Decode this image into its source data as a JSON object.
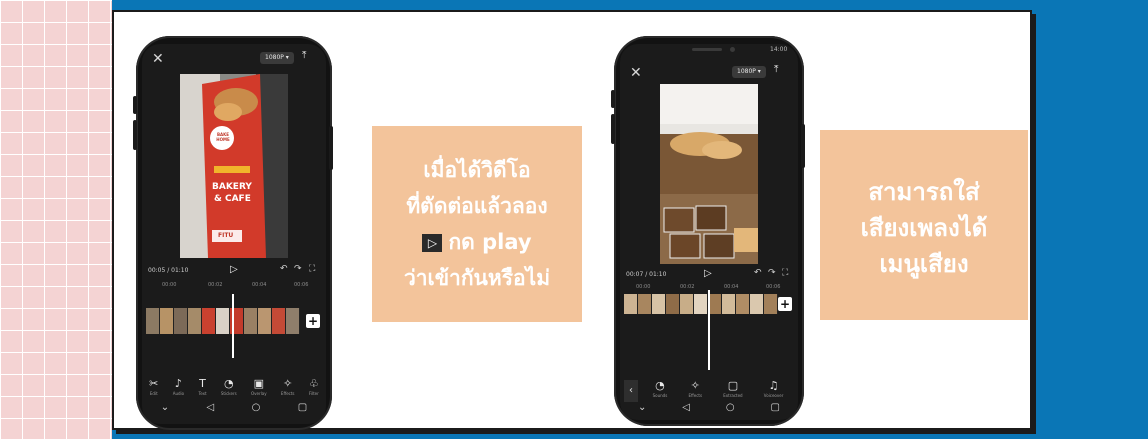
{
  "left_phone": {
    "resolution_label": "1080P ▾",
    "timecode": "00:05 / 01:10",
    "ruler_ticks": [
      "00:00",
      "00:02",
      "00:04",
      "00:06"
    ],
    "banner": {
      "brand": "BAKE HOME",
      "line1": "BAKERY",
      "line2": "& CAFE",
      "footer": "FITU"
    },
    "tools": [
      {
        "icon": "scissors-icon",
        "glyph": "✂",
        "label": "Edit"
      },
      {
        "icon": "music-note-icon",
        "glyph": "♪",
        "label": "Audio"
      },
      {
        "icon": "text-icon",
        "glyph": "T",
        "label": "Text"
      },
      {
        "icon": "sticker-icon",
        "glyph": "◔",
        "label": "Stickers"
      },
      {
        "icon": "overlay-icon",
        "glyph": "▣",
        "label": "Overlay"
      },
      {
        "icon": "effects-icon",
        "glyph": "✧",
        "label": "Effects"
      },
      {
        "icon": "filter-icon",
        "glyph": "♧",
        "label": "Filter"
      }
    ]
  },
  "right_phone": {
    "status_time": "14:00",
    "resolution_label": "1080P ▾",
    "timecode": "00:07 / 01:10",
    "ruler_ticks": [
      "00:00",
      "00:02",
      "00:04",
      "00:06"
    ],
    "tools": [
      {
        "icon": "sounds-icon",
        "glyph": "◔",
        "label": "Sounds"
      },
      {
        "icon": "effects-icon",
        "glyph": "✧",
        "label": "Effects"
      },
      {
        "icon": "extracted-icon",
        "glyph": "▢",
        "label": "Extracted"
      },
      {
        "icon": "voiceover-icon",
        "glyph": "♫",
        "label": "Voiceover"
      }
    ]
  },
  "note_left": {
    "line1": "เมื่อได้วิดีโอ",
    "line2": "ที่ตัดต่อแล้วลอง",
    "play_glyph": "▷",
    "line3": "กด play",
    "line4": "ว่าเข้ากันหรือไม่"
  },
  "note_right": {
    "line1": "สามารถใส่",
    "line2": "เสียงเพลงได้",
    "line3": "เมนูเสียง"
  },
  "colors": {
    "blue_background": "#0a76b6",
    "note_fill": "#f3c49b",
    "phone_body": "#121212"
  }
}
